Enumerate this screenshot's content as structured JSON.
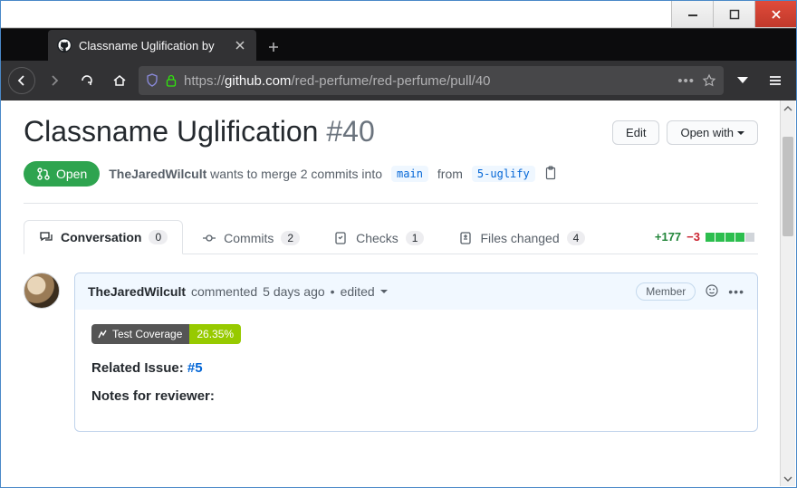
{
  "browser": {
    "tab_title": "Classname Uglification by",
    "url_prefix": "https://",
    "url_domain": "github.com",
    "url_path": "/red-perfume/red-perfume/pull/40"
  },
  "header": {
    "title": "Classname Uglification",
    "number": "#40",
    "edit": "Edit",
    "open_with": "Open with"
  },
  "state": {
    "label": "Open"
  },
  "meta": {
    "author": "TheJaredWilcult",
    "merge_text": "wants to merge 2 commits into",
    "base_branch": "main",
    "from_text": "from",
    "head_branch": "5-uglify"
  },
  "tabs": {
    "conversation": {
      "label": "Conversation",
      "count": "0"
    },
    "commits": {
      "label": "Commits",
      "count": "2"
    },
    "checks": {
      "label": "Checks",
      "count": "1"
    },
    "files": {
      "label": "Files changed",
      "count": "4"
    }
  },
  "diff": {
    "additions": "+177",
    "deletions": "−3"
  },
  "comment": {
    "author": "TheJaredWilcult",
    "commented": "commented",
    "time": "5 days ago",
    "edited": "edited",
    "role": "Member",
    "coverage_label": "Test Coverage",
    "coverage_value": "26.35%",
    "related_label": "Related Issue:",
    "related_link": "#5",
    "notes_label": "Notes for reviewer:"
  }
}
